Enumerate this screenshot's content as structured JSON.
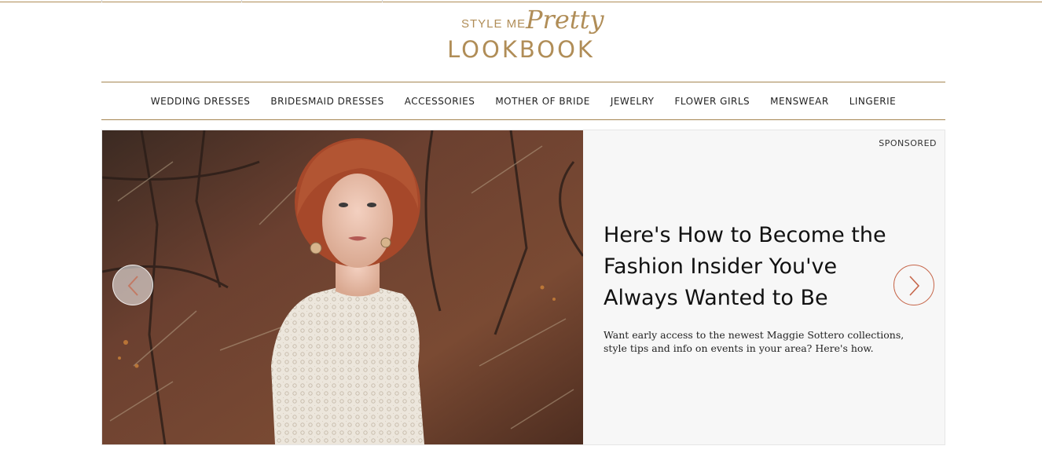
{
  "brand": {
    "small": "STYLE ME",
    "script": "Pretty",
    "main": "LOOKBOOK",
    "color": "#b08d57"
  },
  "nav": {
    "items": [
      "WEDDING DRESSES",
      "BRIDESMAID DRESSES",
      "ACCESSORIES",
      "MOTHER OF BRIDE",
      "JEWELRY",
      "FLOWER GIRLS",
      "MENSWEAR",
      "LINGERIE"
    ]
  },
  "feature": {
    "badge": "SPONSORED",
    "headline": "Here's How to Become the Fashion Insider You've Always Wanted to Be",
    "description": "Want early access to the newest Maggie Sottero collections, style tips and info on events in your area? Here's how.",
    "image_subject": "bride in lace gown, red hair, autumn woods",
    "prev_icon": "chevron-left-icon",
    "next_icon": "chevron-right-icon",
    "arrow_color": "#c6664a"
  }
}
